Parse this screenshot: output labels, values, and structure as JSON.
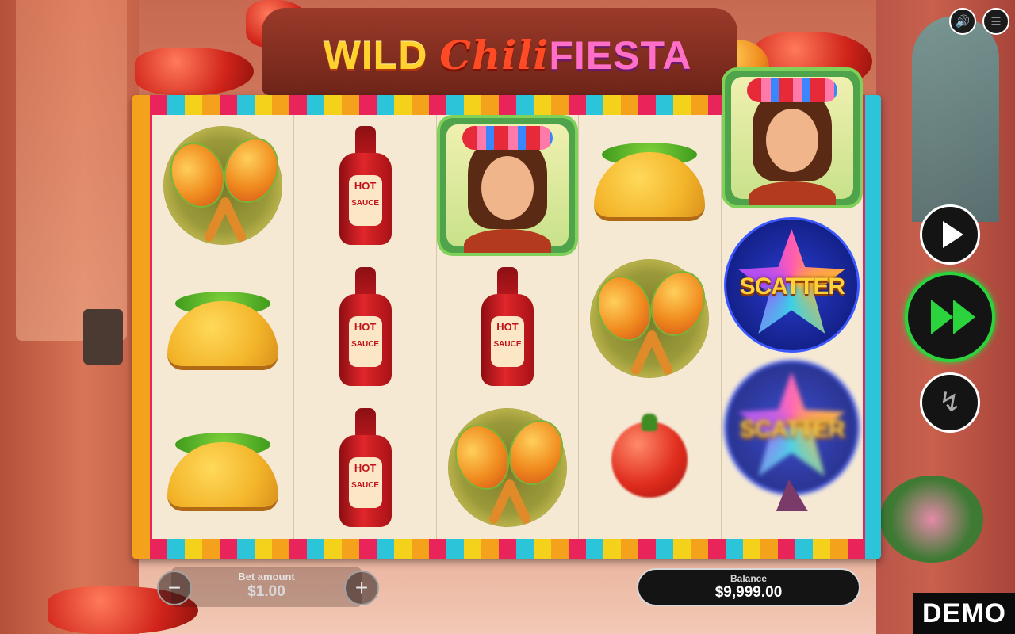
{
  "game": {
    "title_part1": "WILD",
    "title_part2": "Chili",
    "title_part3": "FIESTA"
  },
  "top_controls": {
    "sound_icon": "speaker-icon",
    "menu_icon": "hamburger-menu-icon"
  },
  "reels": [
    [
      "maracas",
      "taco",
      "taco"
    ],
    [
      "hot-sauce",
      "hot-sauce",
      "hot-sauce"
    ],
    [
      "senorita",
      "hot-sauce",
      "maracas"
    ],
    [
      "taco",
      "maracas",
      "tomato"
    ],
    [
      "senorita",
      "scatter",
      "scatter"
    ]
  ],
  "symbols": {
    "hot_sauce_label_line1": "HOT",
    "hot_sauce_label_line2": "SAUCE",
    "scatter_text": "SCATTER"
  },
  "side_controls": {
    "autoplay_icon": "play-icon",
    "spin_icon": "fast-forward-icon",
    "turbo_icon": "lightning-icon"
  },
  "bet": {
    "label": "Bet amount",
    "value": "$1.00",
    "minus": "−",
    "plus": "+"
  },
  "balance": {
    "label": "Balance",
    "value": "$9,999.00"
  },
  "mode_badge": "DEMO",
  "colors": {
    "spin_accent": "#2bd43c",
    "title_yellow": "#ffd22e",
    "title_red": "#ff4a26",
    "title_pink": "#ff6ec7"
  }
}
